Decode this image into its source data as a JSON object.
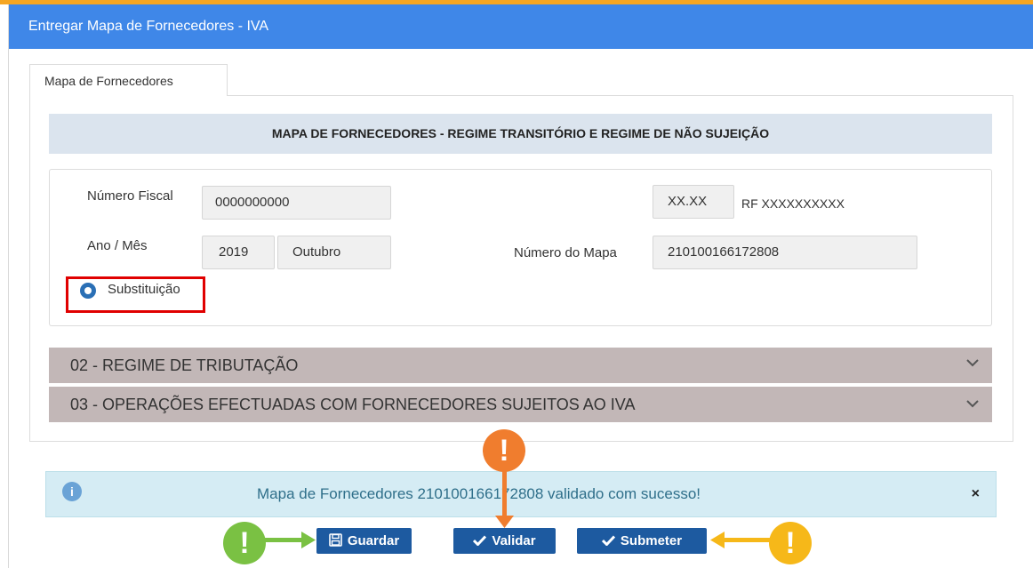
{
  "window": {
    "title": "Entregar Mapa de Fornecedores - IVA"
  },
  "tabs": [
    {
      "label": "Mapa de Fornecedores"
    }
  ],
  "section": {
    "title": "MAPA DE FORNECEDORES - REGIME TRANSITÓRIO E REGIME DE NÃO SUJEIÇÃO"
  },
  "form": {
    "numero_fiscal_label": "Número Fiscal",
    "numero_fiscal_value": "0000000000",
    "rf_code": "XX.XX",
    "rf_text": "RF XXXXXXXXXX",
    "ano_mes_label": "Ano / Mês",
    "ano_value": "2019",
    "mes_value": "Outubro",
    "numero_mapa_label": "Número do Mapa",
    "numero_mapa_value": "210100166172808",
    "substituicao_label": "Substituição"
  },
  "accordions": [
    {
      "label": "02 - REGIME DE TRIBUTAÇÃO"
    },
    {
      "label": "03 - OPERAÇÕES EFECTUADAS COM FORNECEDORES SUJEITOS AO IVA"
    }
  ],
  "alert": {
    "message": "Mapa de Fornecedores 210100166172808 validado com sucesso!",
    "close": "×",
    "info": "i"
  },
  "buttons": {
    "guardar": "Guardar",
    "validar": "Validar",
    "submeter": "Submeter"
  },
  "annotations": {
    "warning_glyph": "!"
  },
  "colors": {
    "titlebar": "#3f87e8",
    "button": "#1d5aa0",
    "accordion": "#c2b7b7",
    "alert_bg": "#d5ecf4",
    "highlight": "#e00000",
    "green_marker": "#7ac143",
    "orange_marker": "#f07d2e",
    "yellow_marker": "#f6b819"
  }
}
